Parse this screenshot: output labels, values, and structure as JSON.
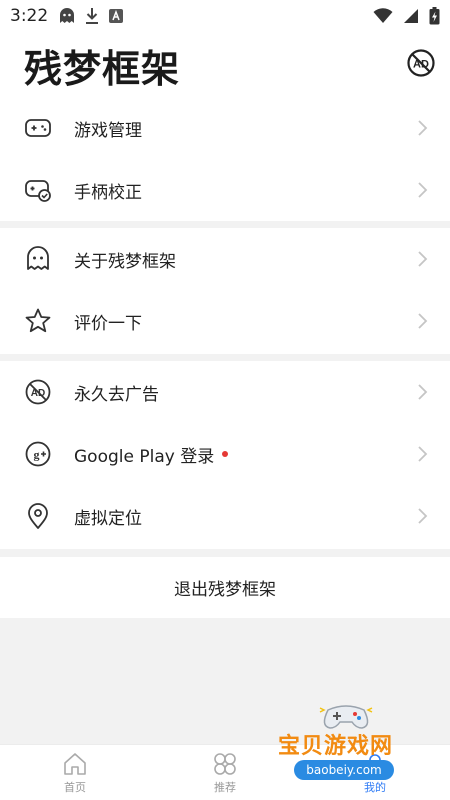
{
  "status_bar": {
    "time": "3:22"
  },
  "header": {
    "title": "残梦框架"
  },
  "menu_groups": [
    {
      "items": [
        {
          "label": "游戏管理",
          "icon": "gamepad-icon"
        },
        {
          "label": "手柄校正",
          "icon": "controller-check-icon"
        }
      ]
    },
    {
      "items": [
        {
          "label": "关于残梦框架",
          "icon": "ghost-icon"
        },
        {
          "label": "评价一下",
          "icon": "star-icon"
        }
      ]
    },
    {
      "items": [
        {
          "label": "永久去广告",
          "icon": "no-ad-icon"
        },
        {
          "label": "Google Play 登录",
          "icon": "google-plus-icon",
          "badge": true
        },
        {
          "label": "虚拟定位",
          "icon": "location-pin-icon"
        }
      ]
    }
  ],
  "logout": {
    "label": "退出残梦框架"
  },
  "bottom_nav": {
    "tabs": [
      {
        "label": "首页",
        "icon": "home-icon"
      },
      {
        "label": "推荐",
        "icon": "grid-icon"
      },
      {
        "label": "我的",
        "icon": "person-icon",
        "active": true
      }
    ]
  },
  "watermark": {
    "title": "宝贝游戏网",
    "subtitle": "baobeiy.com"
  },
  "colors": {
    "accent": "#2f7bf5",
    "badge": "#e53935",
    "separator": "#f2f2f2",
    "watermark_orange": "#f28b12",
    "watermark_blue": "#2a8be2"
  }
}
